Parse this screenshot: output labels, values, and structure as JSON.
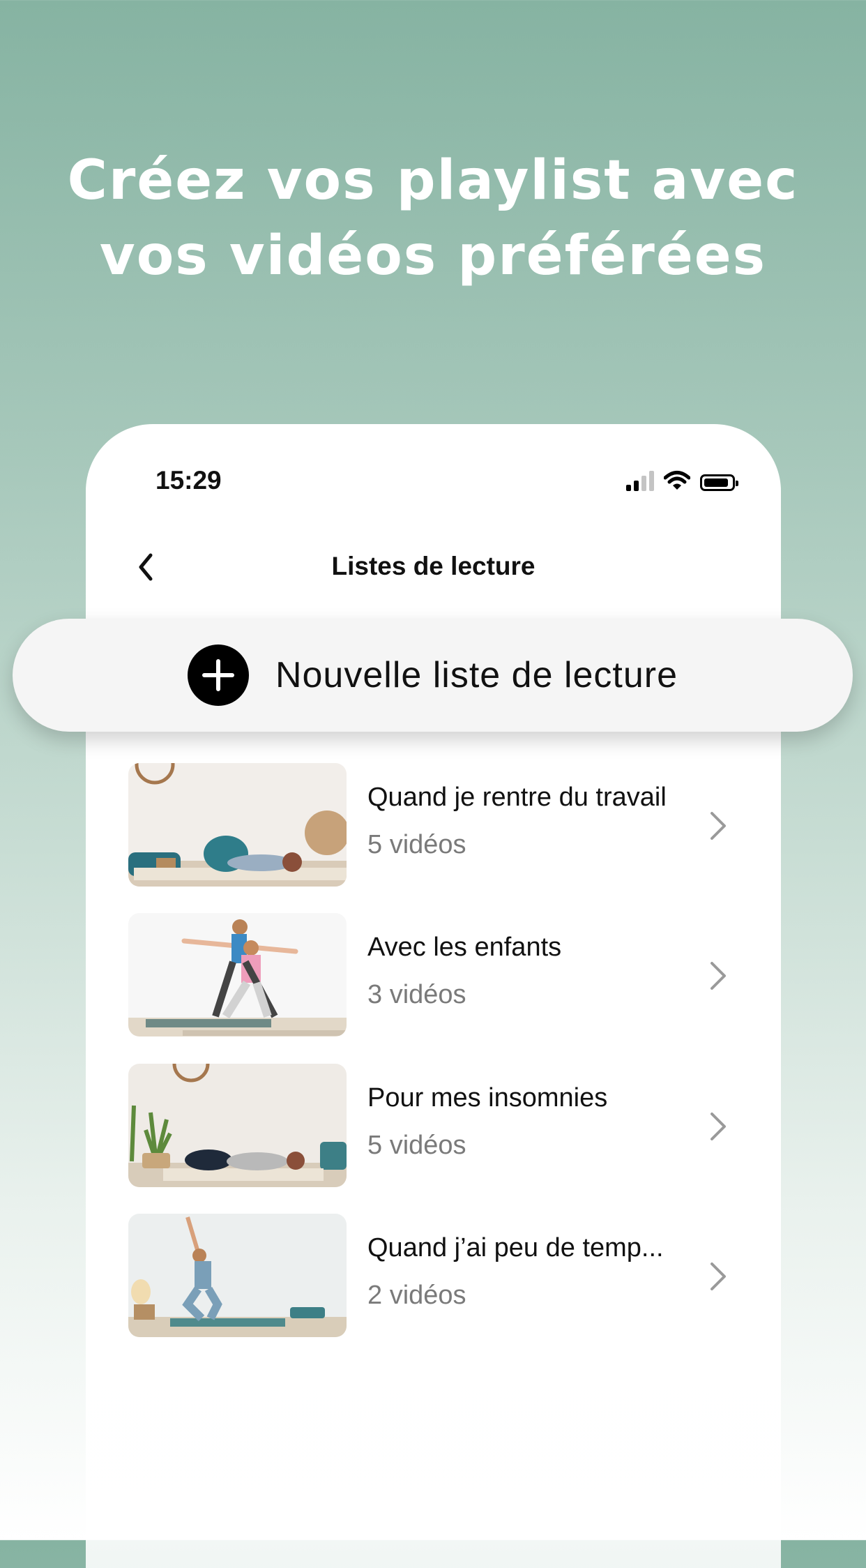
{
  "headline": {
    "line1": "Créez vos playlist avec",
    "line2": "vos vidéos préférées"
  },
  "status_bar": {
    "time": "15:29",
    "icons": [
      "cellular-signal-icon",
      "wifi-icon",
      "battery-icon"
    ]
  },
  "nav": {
    "title": "Listes de lecture",
    "back_icon": "chevron-left-icon"
  },
  "new_playlist": {
    "label": "Nouvelle liste de lecture",
    "icon": "plus-icon"
  },
  "playlists": [
    {
      "title": "Quand je rentre du travail",
      "count": "5 vidéos"
    },
    {
      "title": "Avec les enfants",
      "count": "3 vidéos"
    },
    {
      "title": "Pour mes insomnies",
      "count": "5 vidéos"
    },
    {
      "title": "Quand j’ai peu de temp...",
      "count": "2 vidéos"
    }
  ],
  "colors": {
    "background_top": "#86b3a2",
    "background_bottom": "#ffffff",
    "text_primary": "#111111",
    "text_secondary": "#7a7a7a"
  }
}
